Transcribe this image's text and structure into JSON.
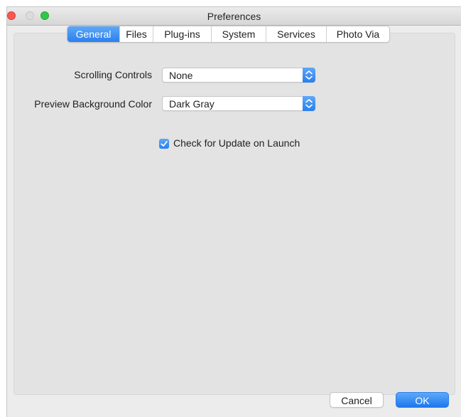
{
  "window": {
    "title": "Preferences"
  },
  "tabs": [
    {
      "label": "General",
      "active": true
    },
    {
      "label": "Files",
      "active": false
    },
    {
      "label": "Plug-ins",
      "active": false
    },
    {
      "label": "System",
      "active": false
    },
    {
      "label": "Services",
      "active": false
    },
    {
      "label": "Photo Via",
      "active": false
    }
  ],
  "general": {
    "scrolling_controls": {
      "label": "Scrolling Controls",
      "value": "None"
    },
    "preview_background": {
      "label": "Preview Background Color",
      "value": "Dark Gray"
    },
    "check_update": {
      "label": "Check for Update on Launch",
      "checked": true
    }
  },
  "footer": {
    "cancel_label": "Cancel",
    "ok_label": "OK"
  },
  "colors": {
    "accent": "#2a7fee",
    "close": "#fc5753",
    "maximize": "#33c748"
  }
}
